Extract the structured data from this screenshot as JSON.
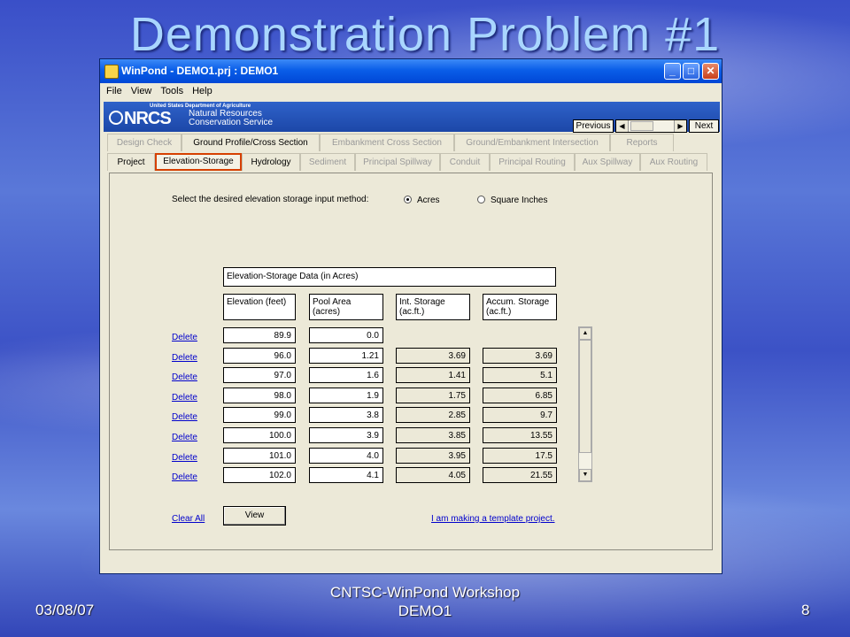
{
  "slide": {
    "title": "Demonstration Problem #1",
    "footer_date": "03/08/07",
    "footer_center_line1": "CNTSC-WinPond Workshop",
    "footer_center_line2": "DEMO1",
    "page_number": "8"
  },
  "window": {
    "title": "WinPond - DEMO1.prj : DEMO1",
    "minimize": "_",
    "maximize": "□",
    "close": "✕"
  },
  "menu": [
    "File",
    "View",
    "Tools",
    "Help"
  ],
  "banner": {
    "top_text": "United States Department of Agriculture",
    "logo": "NRCS",
    "line1": "Natural Resources",
    "line2": "Conservation Service"
  },
  "nav": {
    "previous": "Previous",
    "next": "Next",
    "left_arrow": "◀",
    "right_arrow": "▶"
  },
  "tabs_row1": [
    "Design Check",
    "Ground Profile/Cross Section",
    "Embankment Cross Section",
    "Ground/Embankment Intersection",
    "Reports"
  ],
  "tabs_row2": [
    "Project",
    "Elevation-Storage",
    "Hydrology",
    "Sediment",
    "Principal Spillway",
    "Conduit",
    "Principal Routing",
    "Aux Spillway",
    "Aux Routing"
  ],
  "form": {
    "prompt": "Select the desired elevation storage input method:",
    "option_acres": "Acres",
    "option_sqin": "Square Inches",
    "selected": "Acres",
    "table_title": "Elevation-Storage Data (in Acres)",
    "headers": {
      "elevation": "Elevation (feet)",
      "pool_area_1": "Pool Area",
      "pool_area_2": "(acres)",
      "int_storage_1": "Int. Storage",
      "int_storage_2": "(ac.ft.)",
      "accum_storage_1": "Accum. Storage",
      "accum_storage_2": "(ac.ft.)"
    },
    "delete_label": "Delete",
    "rows": [
      {
        "elev": "89.9",
        "area": "0.0",
        "int": "",
        "accum": ""
      },
      {
        "elev": "96.0",
        "area": "1.21",
        "int": "3.69",
        "accum": "3.69"
      },
      {
        "elev": "97.0",
        "area": "1.6",
        "int": "1.41",
        "accum": "5.1"
      },
      {
        "elev": "98.0",
        "area": "1.9",
        "int": "1.75",
        "accum": "6.85"
      },
      {
        "elev": "99.0",
        "area": "3.8",
        "int": "2.85",
        "accum": "9.7"
      },
      {
        "elev": "100.0",
        "area": "3.9",
        "int": "3.85",
        "accum": "13.55"
      },
      {
        "elev": "101.0",
        "area": "4.0",
        "int": "3.95",
        "accum": "17.5"
      },
      {
        "elev": "102.0",
        "area": "4.1",
        "int": "4.05",
        "accum": "21.55"
      }
    ],
    "clear_all": "Clear All",
    "view_button": "View",
    "template_link": "I am making a template project."
  },
  "scroll": {
    "up": "▲",
    "down": "▼"
  }
}
